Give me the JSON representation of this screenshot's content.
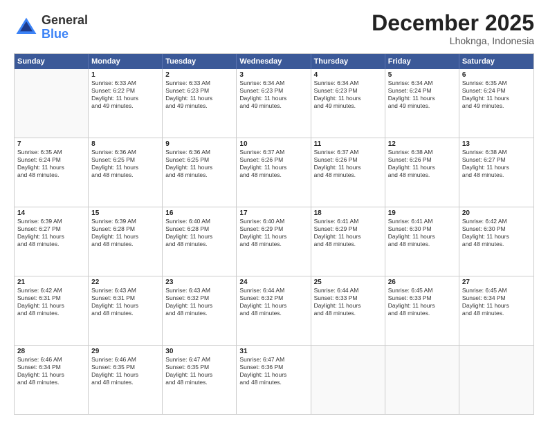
{
  "logo": {
    "general": "General",
    "blue": "Blue"
  },
  "title": {
    "month": "December 2025",
    "location": "Lhoknga, Indonesia"
  },
  "header_days": [
    "Sunday",
    "Monday",
    "Tuesday",
    "Wednesday",
    "Thursday",
    "Friday",
    "Saturday"
  ],
  "weeks": [
    [
      {
        "day": "",
        "empty": true,
        "lines": []
      },
      {
        "day": "1",
        "empty": false,
        "lines": [
          "Sunrise: 6:33 AM",
          "Sunset: 6:22 PM",
          "Daylight: 11 hours",
          "and 49 minutes."
        ]
      },
      {
        "day": "2",
        "empty": false,
        "lines": [
          "Sunrise: 6:33 AM",
          "Sunset: 6:23 PM",
          "Daylight: 11 hours",
          "and 49 minutes."
        ]
      },
      {
        "day": "3",
        "empty": false,
        "lines": [
          "Sunrise: 6:34 AM",
          "Sunset: 6:23 PM",
          "Daylight: 11 hours",
          "and 49 minutes."
        ]
      },
      {
        "day": "4",
        "empty": false,
        "lines": [
          "Sunrise: 6:34 AM",
          "Sunset: 6:23 PM",
          "Daylight: 11 hours",
          "and 49 minutes."
        ]
      },
      {
        "day": "5",
        "empty": false,
        "lines": [
          "Sunrise: 6:34 AM",
          "Sunset: 6:24 PM",
          "Daylight: 11 hours",
          "and 49 minutes."
        ]
      },
      {
        "day": "6",
        "empty": false,
        "lines": [
          "Sunrise: 6:35 AM",
          "Sunset: 6:24 PM",
          "Daylight: 11 hours",
          "and 49 minutes."
        ]
      }
    ],
    [
      {
        "day": "7",
        "empty": false,
        "lines": [
          "Sunrise: 6:35 AM",
          "Sunset: 6:24 PM",
          "Daylight: 11 hours",
          "and 48 minutes."
        ]
      },
      {
        "day": "8",
        "empty": false,
        "lines": [
          "Sunrise: 6:36 AM",
          "Sunset: 6:25 PM",
          "Daylight: 11 hours",
          "and 48 minutes."
        ]
      },
      {
        "day": "9",
        "empty": false,
        "lines": [
          "Sunrise: 6:36 AM",
          "Sunset: 6:25 PM",
          "Daylight: 11 hours",
          "and 48 minutes."
        ]
      },
      {
        "day": "10",
        "empty": false,
        "lines": [
          "Sunrise: 6:37 AM",
          "Sunset: 6:26 PM",
          "Daylight: 11 hours",
          "and 48 minutes."
        ]
      },
      {
        "day": "11",
        "empty": false,
        "lines": [
          "Sunrise: 6:37 AM",
          "Sunset: 6:26 PM",
          "Daylight: 11 hours",
          "and 48 minutes."
        ]
      },
      {
        "day": "12",
        "empty": false,
        "lines": [
          "Sunrise: 6:38 AM",
          "Sunset: 6:26 PM",
          "Daylight: 11 hours",
          "and 48 minutes."
        ]
      },
      {
        "day": "13",
        "empty": false,
        "lines": [
          "Sunrise: 6:38 AM",
          "Sunset: 6:27 PM",
          "Daylight: 11 hours",
          "and 48 minutes."
        ]
      }
    ],
    [
      {
        "day": "14",
        "empty": false,
        "lines": [
          "Sunrise: 6:39 AM",
          "Sunset: 6:27 PM",
          "Daylight: 11 hours",
          "and 48 minutes."
        ]
      },
      {
        "day": "15",
        "empty": false,
        "lines": [
          "Sunrise: 6:39 AM",
          "Sunset: 6:28 PM",
          "Daylight: 11 hours",
          "and 48 minutes."
        ]
      },
      {
        "day": "16",
        "empty": false,
        "lines": [
          "Sunrise: 6:40 AM",
          "Sunset: 6:28 PM",
          "Daylight: 11 hours",
          "and 48 minutes."
        ]
      },
      {
        "day": "17",
        "empty": false,
        "lines": [
          "Sunrise: 6:40 AM",
          "Sunset: 6:29 PM",
          "Daylight: 11 hours",
          "and 48 minutes."
        ]
      },
      {
        "day": "18",
        "empty": false,
        "lines": [
          "Sunrise: 6:41 AM",
          "Sunset: 6:29 PM",
          "Daylight: 11 hours",
          "and 48 minutes."
        ]
      },
      {
        "day": "19",
        "empty": false,
        "lines": [
          "Sunrise: 6:41 AM",
          "Sunset: 6:30 PM",
          "Daylight: 11 hours",
          "and 48 minutes."
        ]
      },
      {
        "day": "20",
        "empty": false,
        "lines": [
          "Sunrise: 6:42 AM",
          "Sunset: 6:30 PM",
          "Daylight: 11 hours",
          "and 48 minutes."
        ]
      }
    ],
    [
      {
        "day": "21",
        "empty": false,
        "lines": [
          "Sunrise: 6:42 AM",
          "Sunset: 6:31 PM",
          "Daylight: 11 hours",
          "and 48 minutes."
        ]
      },
      {
        "day": "22",
        "empty": false,
        "lines": [
          "Sunrise: 6:43 AM",
          "Sunset: 6:31 PM",
          "Daylight: 11 hours",
          "and 48 minutes."
        ]
      },
      {
        "day": "23",
        "empty": false,
        "lines": [
          "Sunrise: 6:43 AM",
          "Sunset: 6:32 PM",
          "Daylight: 11 hours",
          "and 48 minutes."
        ]
      },
      {
        "day": "24",
        "empty": false,
        "lines": [
          "Sunrise: 6:44 AM",
          "Sunset: 6:32 PM",
          "Daylight: 11 hours",
          "and 48 minutes."
        ]
      },
      {
        "day": "25",
        "empty": false,
        "lines": [
          "Sunrise: 6:44 AM",
          "Sunset: 6:33 PM",
          "Daylight: 11 hours",
          "and 48 minutes."
        ]
      },
      {
        "day": "26",
        "empty": false,
        "lines": [
          "Sunrise: 6:45 AM",
          "Sunset: 6:33 PM",
          "Daylight: 11 hours",
          "and 48 minutes."
        ]
      },
      {
        "day": "27",
        "empty": false,
        "lines": [
          "Sunrise: 6:45 AM",
          "Sunset: 6:34 PM",
          "Daylight: 11 hours",
          "and 48 minutes."
        ]
      }
    ],
    [
      {
        "day": "28",
        "empty": false,
        "lines": [
          "Sunrise: 6:46 AM",
          "Sunset: 6:34 PM",
          "Daylight: 11 hours",
          "and 48 minutes."
        ]
      },
      {
        "day": "29",
        "empty": false,
        "lines": [
          "Sunrise: 6:46 AM",
          "Sunset: 6:35 PM",
          "Daylight: 11 hours",
          "and 48 minutes."
        ]
      },
      {
        "day": "30",
        "empty": false,
        "lines": [
          "Sunrise: 6:47 AM",
          "Sunset: 6:35 PM",
          "Daylight: 11 hours",
          "and 48 minutes."
        ]
      },
      {
        "day": "31",
        "empty": false,
        "lines": [
          "Sunrise: 6:47 AM",
          "Sunset: 6:36 PM",
          "Daylight: 11 hours",
          "and 48 minutes."
        ]
      },
      {
        "day": "",
        "empty": true,
        "lines": []
      },
      {
        "day": "",
        "empty": true,
        "lines": []
      },
      {
        "day": "",
        "empty": true,
        "lines": []
      }
    ]
  ]
}
